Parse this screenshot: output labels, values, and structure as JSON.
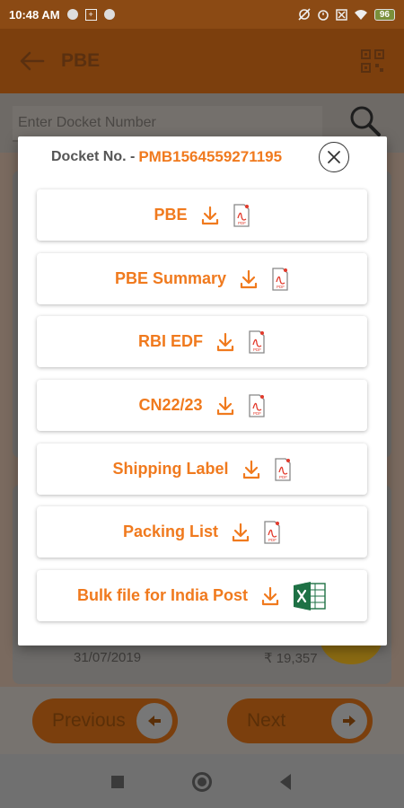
{
  "status_bar": {
    "time": "10:48 AM",
    "battery": "96"
  },
  "app_bar": {
    "title": "PBE",
    "back_icon": "arrow-left-icon",
    "scan_icon": "qr-code-icon"
  },
  "search": {
    "placeholder": "Enter Docket Number"
  },
  "background_record": {
    "date": "31/07/2019",
    "amount": "₹ 19,357"
  },
  "navigation": {
    "previous_label": "Previous",
    "next_label": "Next"
  },
  "dialog": {
    "label": "Docket No. -",
    "docket_number": "PMB1564559271195",
    "options": [
      {
        "label": "PBE",
        "file_icon": "pdf-icon"
      },
      {
        "label": "PBE Summary",
        "file_icon": "pdf-icon"
      },
      {
        "label": "RBI EDF",
        "file_icon": "pdf-icon"
      },
      {
        "label": "CN22/23",
        "file_icon": "pdf-icon"
      },
      {
        "label": "Shipping Label",
        "file_icon": "pdf-icon"
      },
      {
        "label": "Packing List",
        "file_icon": "pdf-icon"
      },
      {
        "label": "Bulk file for India Post",
        "file_icon": "excel-icon"
      }
    ]
  },
  "colors": {
    "accent": "#f07a1e",
    "app_bar": "#7c3f0d"
  }
}
